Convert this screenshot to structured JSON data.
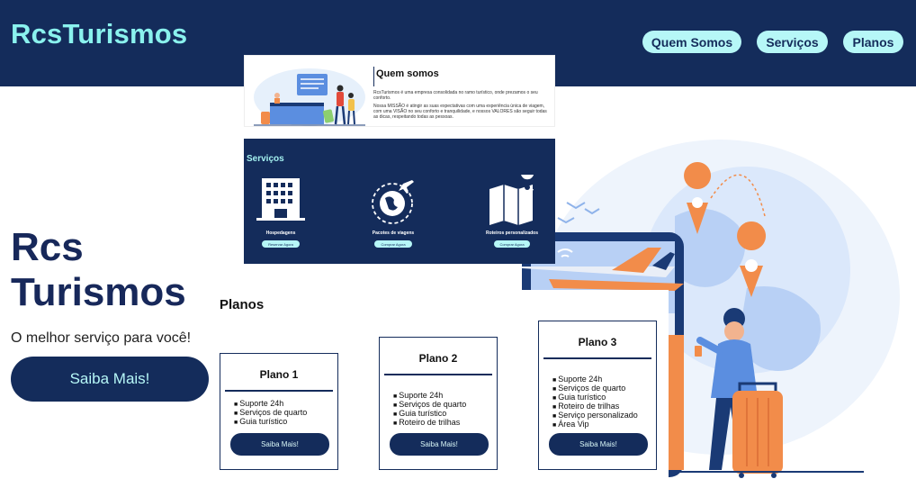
{
  "header": {
    "brand": "RcsTurismos",
    "nav": [
      "Quem Somos",
      "Serviços",
      "Planos"
    ]
  },
  "hero": {
    "title": "Rcs Turismos",
    "subtitle": "O melhor serviço para você!",
    "cta": "Saiba Mais!"
  },
  "about": {
    "title": "Quem somos",
    "p1": "RcsTurismos é uma empresa consolidada no ramo turístico, onde prezamos o seu conforto.",
    "p2": "Nossa MISSÃO é atingir as suas expectativas com uma experiência única de viagem, com uma VISÃO no seu conforto e tranquilidade, e nossos VALORES são seguir todas as dicas, respeitando todas as pessoas."
  },
  "services": {
    "title": "Serviços",
    "items": [
      {
        "label": "Hospedagens",
        "button": "Reservar Agora",
        "icon": "hotel-building-icon"
      },
      {
        "label": "Pacotes de viagens",
        "button": "Comprar Agora",
        "icon": "globe-plane-icon"
      },
      {
        "label": "Roteiros personalizados",
        "button": "Comprar Agora",
        "icon": "map-pin-icon"
      }
    ]
  },
  "plans": {
    "title": "Planos",
    "items": [
      {
        "name": "Plano 1",
        "features": [
          "Suporte 24h",
          "Serviços de quarto",
          "Guia turístico"
        ],
        "button": "Saiba Mais!"
      },
      {
        "name": "Plano 2",
        "features": [
          "Suporte 24h",
          "Serviços de quarto",
          "Guia turístico",
          "Roteiro de trilhas"
        ],
        "button": "Saiba Mais!"
      },
      {
        "name": "Plano 3",
        "features": [
          "Suporte 24h",
          "Serviços de quarto",
          "Guia turístico",
          "Roteiro de trilhas",
          "Serviço personalizado",
          "Área Vip"
        ],
        "button": "Saiba Mais!"
      }
    ]
  },
  "colors": {
    "navy": "#142c5b",
    "accent": "#8af2ee",
    "pill": "#b6f7f7",
    "orange": "#f28c4a"
  }
}
